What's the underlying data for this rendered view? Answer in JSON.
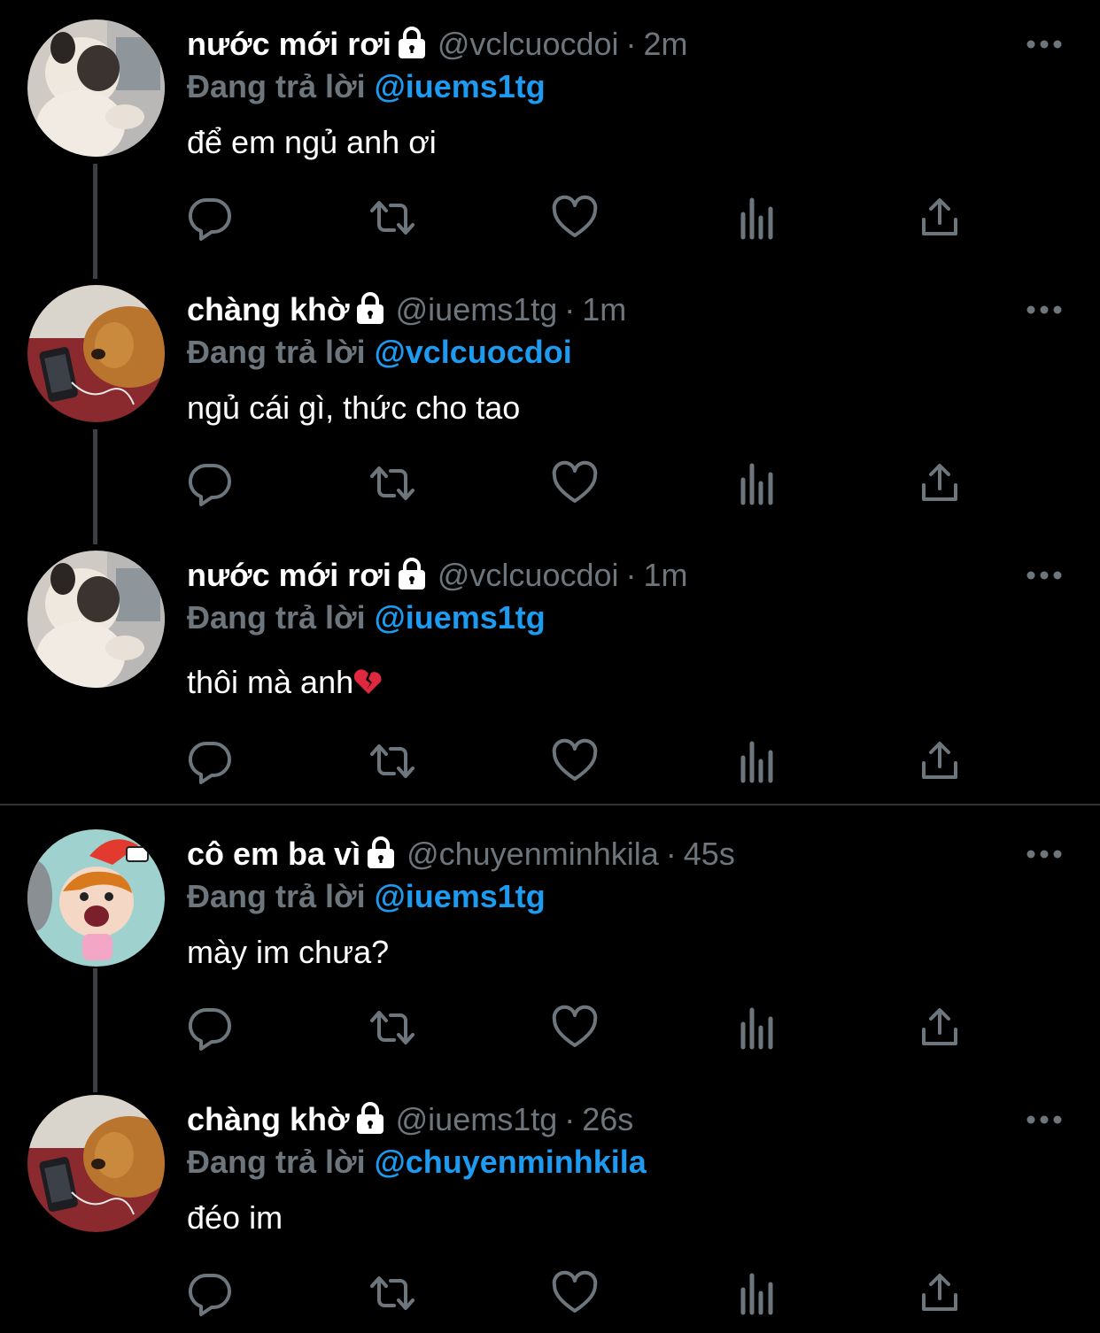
{
  "tweets": [
    {
      "display_name": "nước mới rơi",
      "handle": "@vclcuocdoi",
      "time": "2m",
      "reply_prefix": "Đang trả lời",
      "reply_to": "@iuems1tg",
      "text": "để em ngủ anh ơi"
    },
    {
      "display_name": "chàng khờ",
      "handle": "@iuems1tg",
      "time": "1m",
      "reply_prefix": "Đang trả lời",
      "reply_to": "@vclcuocdoi",
      "text": "ngủ cái gì, thức cho tao"
    },
    {
      "display_name": "nước mới rơi",
      "handle": "@vclcuocdoi",
      "time": "1m",
      "reply_prefix": "Đang trả lời",
      "reply_to": "@iuems1tg",
      "text": "thôi mà anh",
      "emoji": "broken-heart-emoji"
    },
    {
      "display_name": "cô em ba vì",
      "handle": "@chuyenminhkila",
      "time": "45s",
      "reply_prefix": "Đang trả lời",
      "reply_to": "@iuems1tg",
      "text": "mày im chưa?"
    },
    {
      "display_name": "chàng khờ",
      "handle": "@iuems1tg",
      "time": "26s",
      "reply_prefix": "Đang trả lời",
      "reply_to": "@chuyenminhkila",
      "text": "đéo im"
    }
  ],
  "separator": "·",
  "icons": [
    "lock-icon",
    "more-icon",
    "reply-icon",
    "retweet-icon",
    "like-icon",
    "analytics-icon",
    "share-icon"
  ],
  "colors": {
    "background": "#000000",
    "text": "#ffffff",
    "secondary": "#6e767d",
    "mention": "#1d9bf0",
    "thread_line": "#3b3f43",
    "icon": "#6e767d",
    "divider": "#2f3336"
  }
}
